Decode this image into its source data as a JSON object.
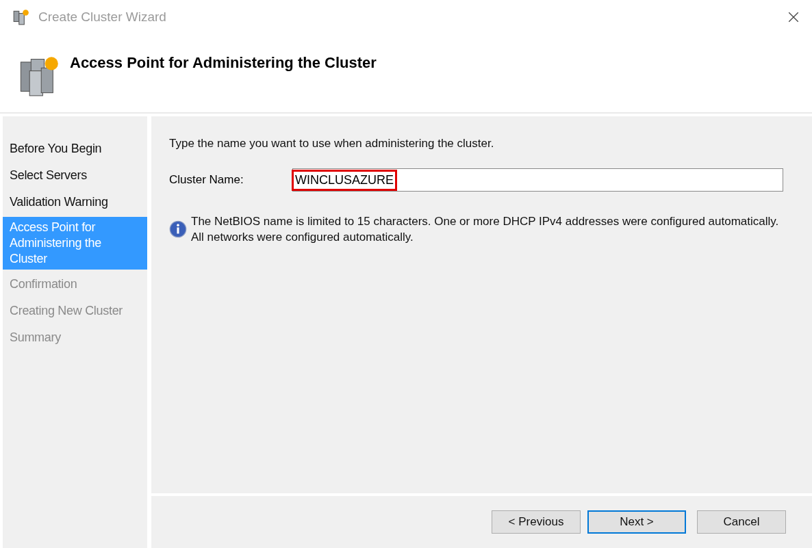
{
  "window": {
    "title": "Create Cluster Wizard"
  },
  "header": {
    "title": "Access Point for Administering the Cluster"
  },
  "steps": [
    {
      "label": "Before You Begin",
      "selected": false,
      "disabled": false
    },
    {
      "label": "Select Servers",
      "selected": false,
      "disabled": false
    },
    {
      "label": "Validation Warning",
      "selected": false,
      "disabled": false
    },
    {
      "label": "Access Point for Administering the Cluster",
      "selected": true,
      "disabled": false
    },
    {
      "label": "Confirmation",
      "selected": false,
      "disabled": true
    },
    {
      "label": "Creating New Cluster",
      "selected": false,
      "disabled": true
    },
    {
      "label": "Summary",
      "selected": false,
      "disabled": true
    }
  ],
  "content": {
    "instruction": "Type the name you want to use when administering the cluster.",
    "field": {
      "label": "Cluster Name:",
      "value": "WINCLUSAZURE",
      "highlighted": true
    },
    "info": "The NetBIOS name is limited to 15 characters.  One or more DHCP IPv4 addresses were configured automatically.  All networks were configured automatically."
  },
  "buttons": [
    {
      "label": "< Previous",
      "default": false
    },
    {
      "label": "Next >",
      "default": true
    },
    {
      "label": "Cancel",
      "default": false
    }
  ]
}
